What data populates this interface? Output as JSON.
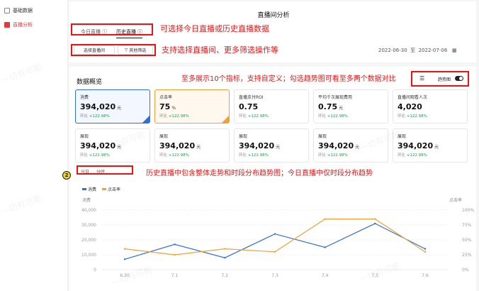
{
  "sidebar": {
    "items": [
      {
        "label": "基础数据"
      },
      {
        "label": "直播分析"
      }
    ]
  },
  "page": {
    "title": "直播间分析"
  },
  "tabs": [
    {
      "label": "今日直播"
    },
    {
      "label": "历史直播"
    }
  ],
  "filters": {
    "select_live": "选择直播间",
    "more_filter": "其他筛选"
  },
  "date_range": {
    "start": "2022-06-30",
    "sep": "至",
    "end": "2022-07-06"
  },
  "annotations": {
    "a1": "可选择今日直播或历史直播数据",
    "a2": "支持选择直播间、更多筛选操作等",
    "a3": "至多展示10个指标，支持自定义；勾选趋势图可看至多两个数据对比",
    "a4": "历史直播中包含整体走势和时段分布趋势图；今日直播中仅时段分布趋势"
  },
  "overview": {
    "title": "数据概览",
    "trend_label": "趋势图"
  },
  "cards": [
    {
      "name": "消费",
      "value": "394,020",
      "unit": "元",
      "cmp_label": "环比",
      "cmp": "+122.98%"
    },
    {
      "name": "点击率",
      "value": "75",
      "unit": "%",
      "cmp_label": "环比",
      "cmp": "+122.98%"
    },
    {
      "name": "直播支付ROI",
      "value": "0.75",
      "unit": "",
      "cmp_label": "环比",
      "cmp": "+122.98%"
    },
    {
      "name": "平均千次展现费用",
      "value": "0.75",
      "unit": "元",
      "cmp_label": "环比",
      "cmp": "+122.98%"
    },
    {
      "name": "直播间观看人次",
      "value": "4,020",
      "unit": "",
      "cmp_label": "环比",
      "cmp": "+122.98%"
    },
    {
      "name": "展现",
      "value": "394,020",
      "unit": "元",
      "cmp_label": "环比",
      "cmp": "+122.98%"
    },
    {
      "name": "展现",
      "value": "394,020",
      "unit": "元",
      "cmp_label": "环比",
      "cmp": "+122.98%"
    },
    {
      "name": "展现",
      "value": "394,020",
      "unit": "元",
      "cmp_label": "环比",
      "cmp": "+122.98%"
    },
    {
      "name": "展现",
      "value": "394,020",
      "unit": "元",
      "cmp_label": "环比",
      "cmp": "+122.98%"
    },
    {
      "name": "展现",
      "value": "394,020",
      "unit": "元",
      "cmp_label": "环比",
      "cmp": "+122.98%"
    }
  ],
  "chart_tabs": [
    {
      "label": "分日"
    },
    {
      "label": "分时"
    }
  ],
  "badge": "2",
  "watermark": "一切有可能",
  "colors": {
    "accent": "#e4393c",
    "blue": "#2f6fd6",
    "orange": "#f0a037",
    "green": "#19a049"
  },
  "chart_data": {
    "type": "line",
    "x": [
      "6.30",
      "7.1",
      "7.2",
      "7.3",
      "7.4",
      "7.5",
      "7.6"
    ],
    "series": [
      {
        "name": "消费",
        "axis": "left",
        "values": [
          7000,
          17000,
          8000,
          24000,
          15000,
          31000,
          14000
        ]
      },
      {
        "name": "点击率",
        "axis": "right",
        "values": [
          35,
          25,
          35,
          30,
          85,
          85,
          30
        ]
      }
    ],
    "left_axis": {
      "label": "消费",
      "ticks": [
        "0",
        "10,000",
        "20,000",
        "30,000",
        "40,000"
      ],
      "ylim": [
        0,
        40000
      ]
    },
    "right_axis": {
      "label": "点击率",
      "ticks": [
        "0%",
        "25%",
        "50%",
        "75%",
        "100%"
      ],
      "ylim": [
        0,
        100
      ]
    },
    "grid": true,
    "legend": "top-left"
  }
}
